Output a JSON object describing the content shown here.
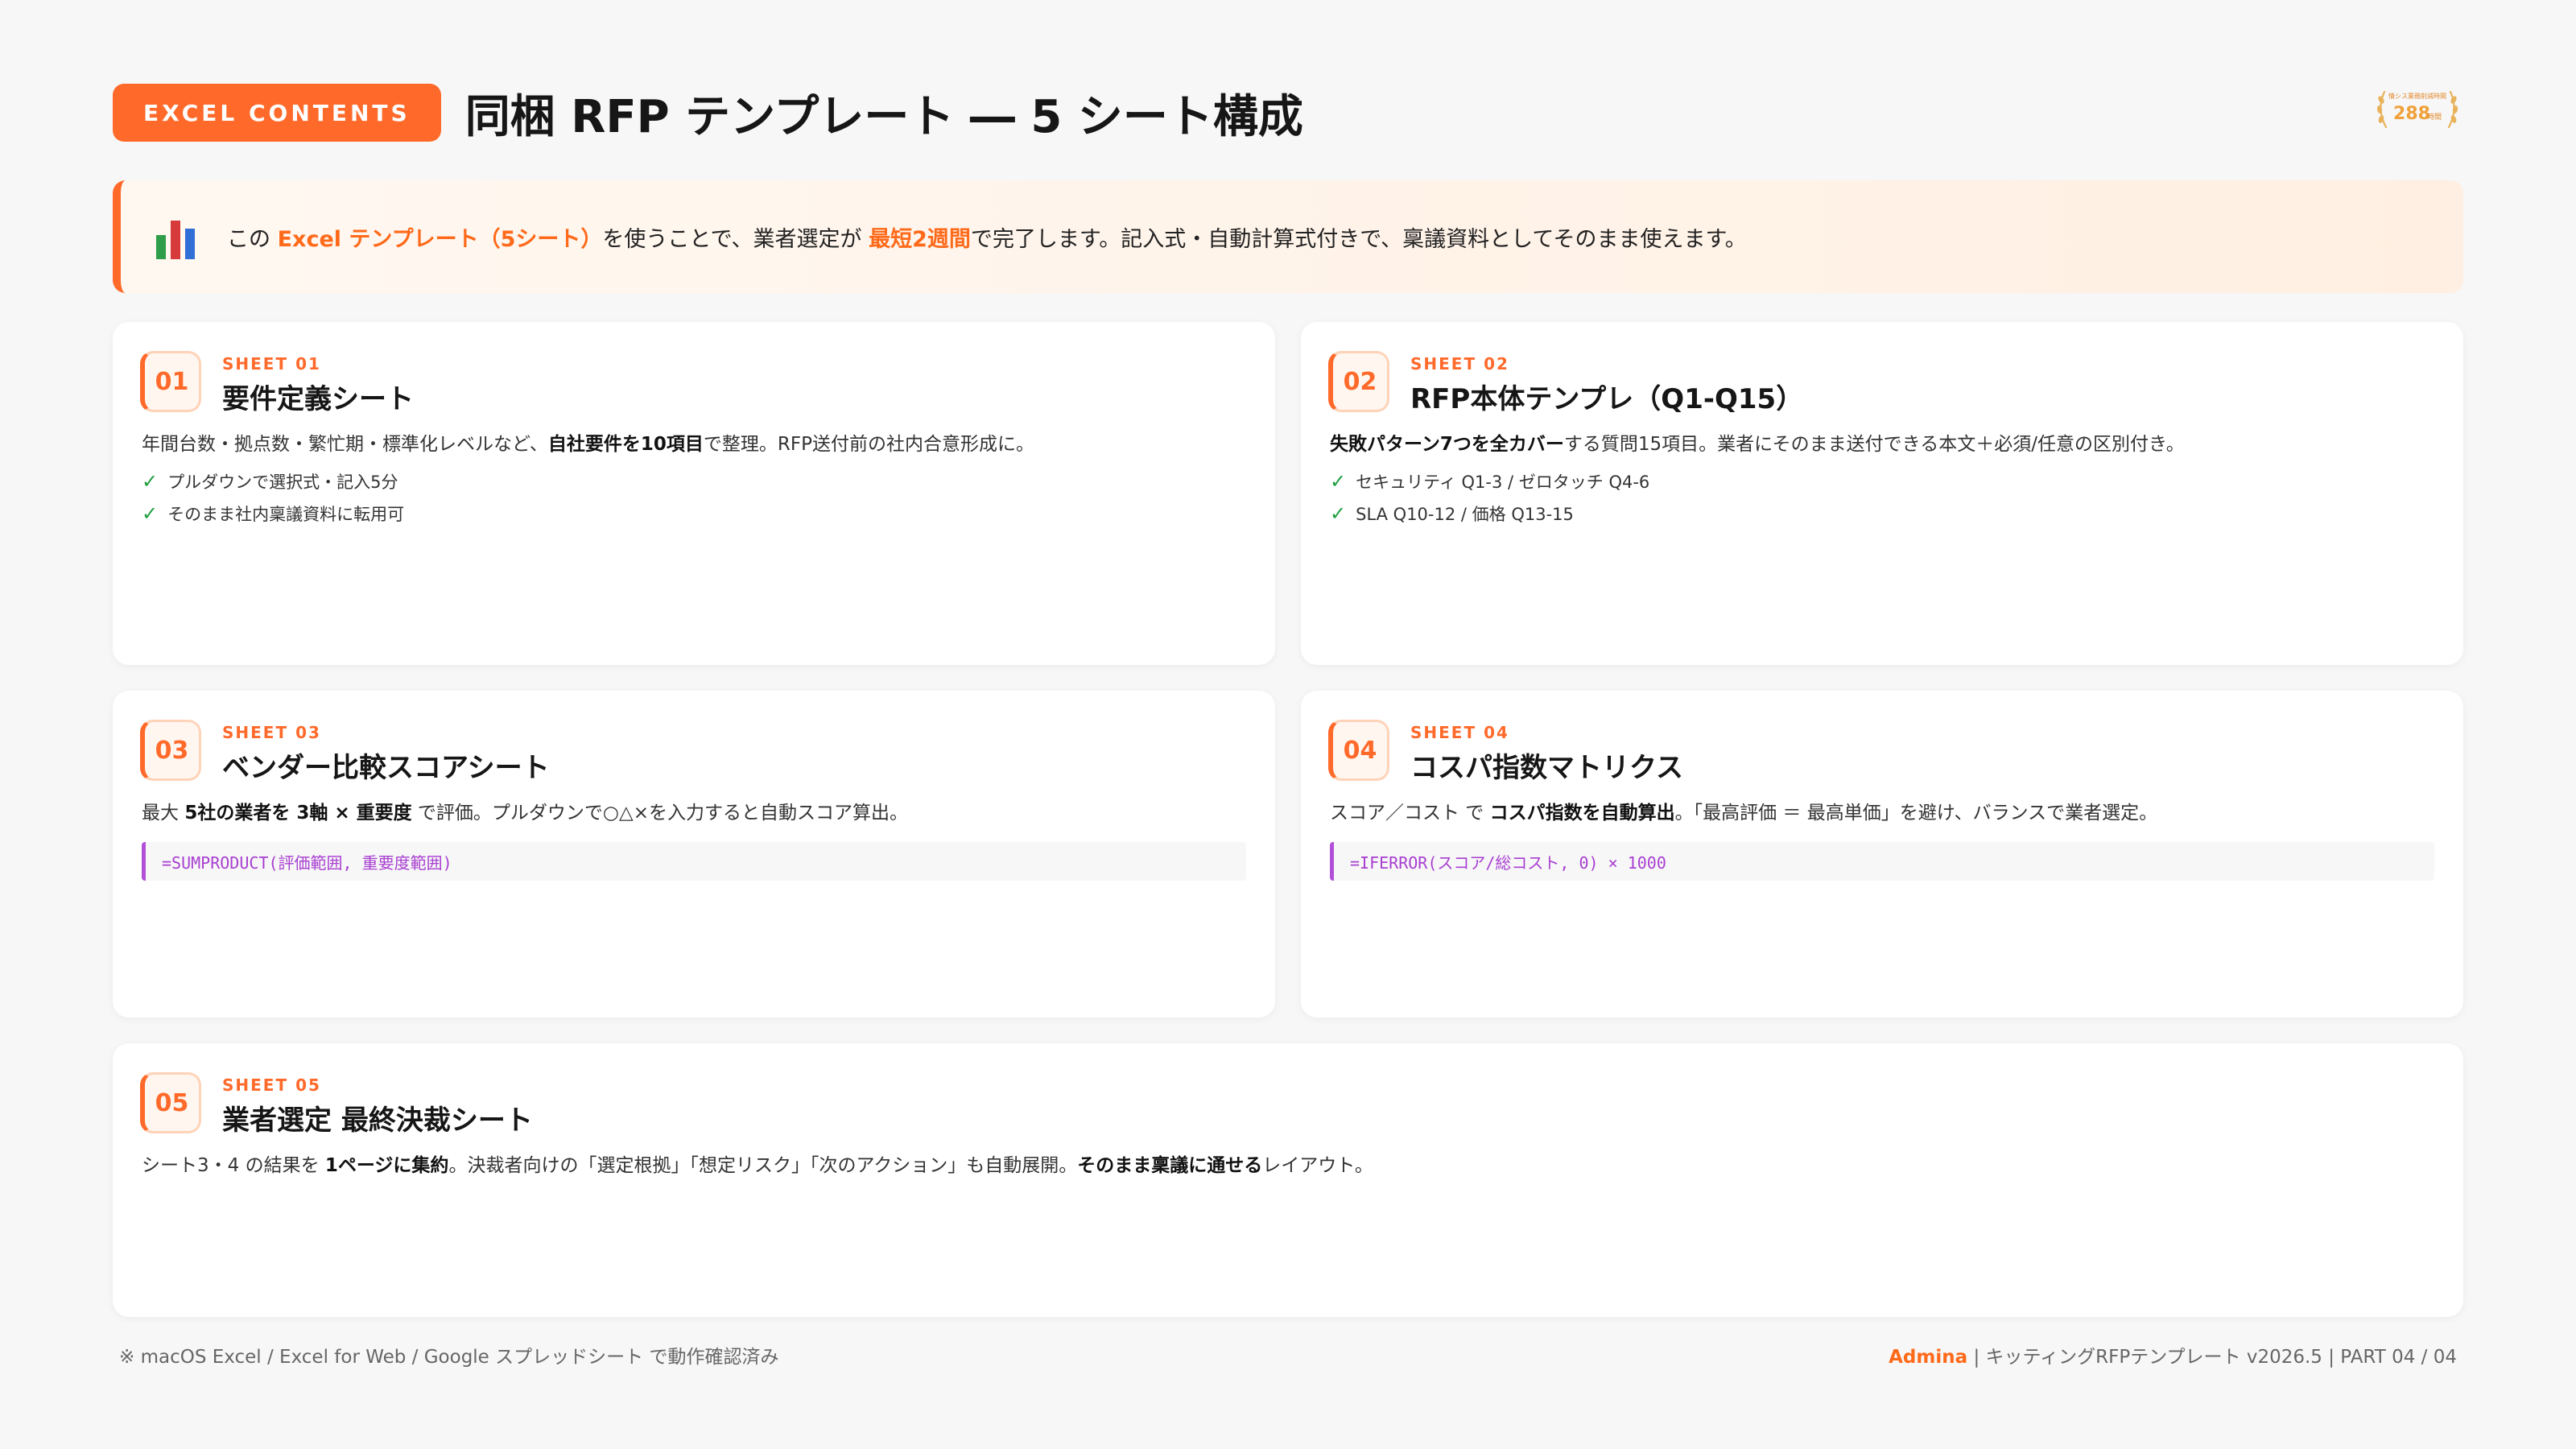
{
  "header": {
    "pill": "EXCEL CONTENTS",
    "title": "同梱 RFP テンプレート ― 5 シート構成",
    "badge_line1": "情シス業務削減時間",
    "badge_number": "288",
    "badge_unit": "時間"
  },
  "callout": {
    "icon": "bar-chart-icon",
    "p1": "この ",
    "h1": "Excel テンプレート（5シート）",
    "p2": "を使うことで、業者選定が ",
    "h2": "最短2週間",
    "p3": "で完了します。記入式・自動計算式付きで、稟議資料としてそのまま使えます。"
  },
  "cards": [
    {
      "num": "01",
      "label": "SHEET 01",
      "title": "要件定義シート",
      "desc_pre": "年間台数・拠点数・繁忙期・標準化レベルなど、",
      "desc_b1": "自社要件を10項目",
      "desc_post": "で整理。RFP送付前の社内合意形成に。",
      "bullets": [
        "プルダウンで選択式・記入5分",
        "そのまま社内稟議資料に転用可"
      ]
    },
    {
      "num": "02",
      "label": "SHEET 02",
      "title": "RFP本体テンプレ（Q1-Q15）",
      "desc_b1": "失敗パターン7つを全カバー",
      "desc_post": "する質問15項目。業者にそのまま送付できる本文＋必須/任意の区別付き。",
      "bullets": [
        "セキュリティ Q1-3 / ゼロタッチ Q4-6",
        "SLA Q10-12 / 価格 Q13-15"
      ]
    },
    {
      "num": "03",
      "label": "SHEET 03",
      "title": "ベンダー比較スコアシート",
      "desc_pre": "最大 ",
      "desc_b1": "5社の業者を 3軸 × 重要度",
      "desc_post": " で評価。プルダウンで○△×を入力すると自動スコア算出。",
      "formula": "=SUMPRODUCT(評価範囲, 重要度範囲)"
    },
    {
      "num": "04",
      "label": "SHEET 04",
      "title": "コスパ指数マトリクス",
      "desc_pre": "スコア／コスト で ",
      "desc_b1": "コスパ指数を自動算出",
      "desc_post": "。「最高評価 ＝ 最高単価」を避け、バランスで業者選定。",
      "formula": "=IFERROR(スコア/総コスト, 0) × 1000"
    },
    {
      "num": "05",
      "label": "SHEET 05",
      "title": "業者選定 最終決裁シート",
      "desc_pre": "シート3・4 の結果を ",
      "desc_b1": "1ページに集約",
      "desc_mid": "。決裁者向けの「選定根拠」「想定リスク」「次のアクション」も自動展開。",
      "desc_b2": "そのまま稟議に通せる",
      "desc_post": "レイアウト。"
    }
  ],
  "footer": {
    "note": "※ macOS Excel / Excel for Web / Google スプレッドシート で動作確認済み",
    "brand": "Admina",
    "meta": " | キッティングRFPテンプレート v2026.5 | PART 04 / 04"
  },
  "colors": {
    "accent": "#ff6a2b",
    "check": "#1e9e3e",
    "formula": "#a83fd0"
  }
}
